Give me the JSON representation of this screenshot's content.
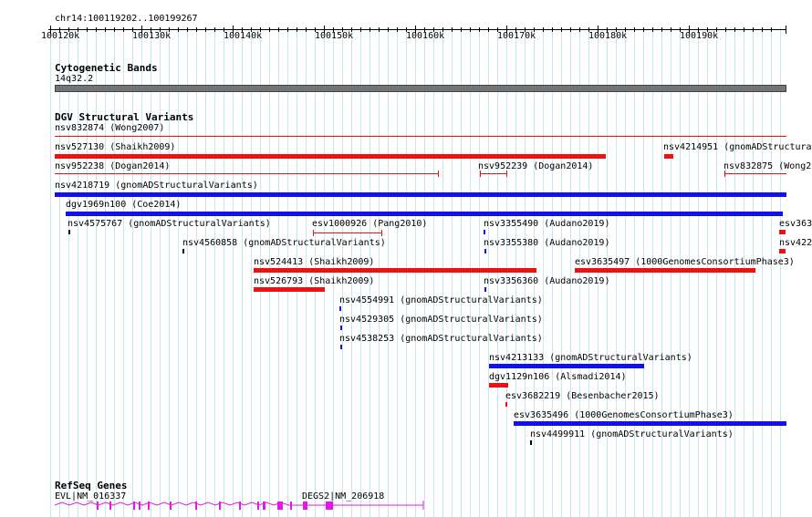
{
  "location": "chr14:100119202..100199267",
  "ruler": {
    "labels": [
      "100120k",
      "100130k",
      "100140k",
      "100150k",
      "100160k",
      "100170k",
      "100180k",
      "100190k"
    ]
  },
  "tracks": {
    "cyto": {
      "title": "Cytogenetic Bands",
      "band": "14q32.2"
    },
    "dgv": {
      "title": "DGV Structural Variants",
      "features": [
        {
          "id": "nsv832874 (Wong2007)",
          "color": "red"
        },
        {
          "id": "nsv527130 (Shaikh2009)",
          "color": "red"
        },
        {
          "id": "nsv4214951 (gnomADStructura",
          "color": "red"
        },
        {
          "id": "nsv952238 (Dogan2014)",
          "color": "red"
        },
        {
          "id": "nsv952239 (Dogan2014)",
          "color": "red"
        },
        {
          "id": "nsv832875 (Wong20",
          "color": "red"
        },
        {
          "id": "nsv4218719 (gnomADStructuralVariants)",
          "color": "blue"
        },
        {
          "id": "dgv1969n100 (Coe2014)",
          "color": "blue"
        },
        {
          "id": "nsv4575767 (gnomADStructuralVariants)",
          "color": "black"
        },
        {
          "id": "esv1000926 (Pang2010)",
          "color": "red"
        },
        {
          "id": "nsv3355490 (Audano2019)",
          "color": "blue"
        },
        {
          "id": "esv363",
          "color": "red"
        },
        {
          "id": "nsv4560858 (gnomADStructuralVariants)",
          "color": "black"
        },
        {
          "id": "nsv3355380 (Audano2019)",
          "color": "blue"
        },
        {
          "id": "nsv422",
          "color": "red"
        },
        {
          "id": "nsv524413 (Shaikh2009)",
          "color": "red"
        },
        {
          "id": "esv3635497 (1000GenomesConsortiumPhase3)",
          "color": "red"
        },
        {
          "id": "nsv526793 (Shaikh2009)",
          "color": "red"
        },
        {
          "id": "nsv3356360 (Audano2019)",
          "color": "blue"
        },
        {
          "id": "nsv4554991 (gnomADStructuralVariants)",
          "color": "blue"
        },
        {
          "id": "nsv4529305 (gnomADStructuralVariants)",
          "color": "blue"
        },
        {
          "id": "nsv4538253 (gnomADStructuralVariants)",
          "color": "blue"
        },
        {
          "id": "nsv4213133 (gnomADStructuralVariants)",
          "color": "blue"
        },
        {
          "id": "dgv1129n106 (Alsmadi2014)",
          "color": "red"
        },
        {
          "id": "esv3682219 (Besenbacher2015)",
          "color": "red"
        },
        {
          "id": "esv3635496 (1000GenomesConsortiumPhase3)",
          "color": "blue"
        },
        {
          "id": "nsv4499911 (gnomADStructuralVariants)",
          "color": "black"
        }
      ]
    },
    "refseq": {
      "title": "RefSeq Genes",
      "genes": [
        {
          "id": "EVL|NM_016337"
        },
        {
          "id": "DEGS2|NM_206918"
        }
      ]
    }
  },
  "colors": {
    "deletion": "#ee1111",
    "gain": "#1111ee",
    "gene": "#e418e4",
    "band": "#747474",
    "grid": "#c9e6f0"
  }
}
